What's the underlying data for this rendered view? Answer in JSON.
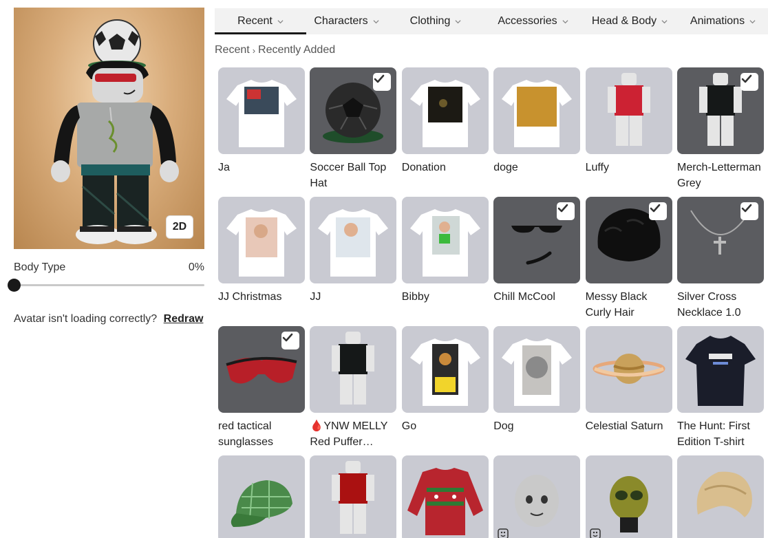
{
  "preview": {
    "toggle_label": "2D"
  },
  "body_type": {
    "label": "Body Type",
    "value": "0%",
    "fraction": 0
  },
  "redraw": {
    "text": "Avatar isn't loading correctly?",
    "link": "Redraw"
  },
  "tabs": [
    {
      "label": "Recent",
      "active": true
    },
    {
      "label": "Characters",
      "active": false
    },
    {
      "label": "Clothing",
      "active": false
    },
    {
      "label": "Accessories",
      "active": false
    },
    {
      "label": "Head & Body",
      "active": false
    },
    {
      "label": "Animations",
      "active": false
    }
  ],
  "breadcrumb": {
    "root": "Recent",
    "current": "Recently Added"
  },
  "items": [
    {
      "name": "Ja",
      "kind": "shirt",
      "worn": false,
      "dynamic": false
    },
    {
      "name": "Soccer Ball Top Hat",
      "kind": "soccer-hat",
      "worn": true,
      "dynamic": false
    },
    {
      "name": "Donation",
      "kind": "shirt",
      "worn": false,
      "dynamic": false
    },
    {
      "name": "doge",
      "kind": "shirt",
      "worn": false,
      "dynamic": false
    },
    {
      "name": "Luffy",
      "kind": "outfit",
      "worn": false,
      "dynamic": false
    },
    {
      "name": "Merch-Letterman Grey",
      "kind": "outfit",
      "worn": true,
      "dynamic": false
    },
    {
      "name": "JJ Christmas",
      "kind": "shirt",
      "worn": false,
      "dynamic": false
    },
    {
      "name": "JJ",
      "kind": "shirt",
      "worn": false,
      "dynamic": false
    },
    {
      "name": "Bibby",
      "kind": "shirt",
      "worn": false,
      "dynamic": false
    },
    {
      "name": "Chill McCool",
      "kind": "face",
      "worn": true,
      "dynamic": false
    },
    {
      "name": "Messy Black Curly Hair",
      "kind": "hair",
      "worn": true,
      "dynamic": false
    },
    {
      "name": "Silver Cross Necklace 1.0",
      "kind": "necklace",
      "worn": true,
      "dynamic": false
    },
    {
      "name": "red tactical sunglasses",
      "kind": "sunglasses",
      "worn": true,
      "dynamic": false
    },
    {
      "name": "🩸YNW MELLY Red Puffer…",
      "kind": "outfit",
      "worn": false,
      "dynamic": false
    },
    {
      "name": "Go",
      "kind": "shirt",
      "worn": false,
      "dynamic": false
    },
    {
      "name": "Dog",
      "kind": "shirt",
      "worn": false,
      "dynamic": false
    },
    {
      "name": "Celestial Saturn",
      "kind": "saturn",
      "worn": false,
      "dynamic": false
    },
    {
      "name": "The Hunt: First Edition T-shirt",
      "kind": "tshirt",
      "worn": false,
      "dynamic": false
    },
    {
      "name": "",
      "kind": "cap",
      "worn": false,
      "dynamic": false
    },
    {
      "name": "",
      "kind": "outfit",
      "worn": false,
      "dynamic": false
    },
    {
      "name": "",
      "kind": "sweater",
      "worn": false,
      "dynamic": false
    },
    {
      "name": "",
      "kind": "head",
      "worn": false,
      "dynamic": true
    },
    {
      "name": "",
      "kind": "alien-head",
      "worn": false,
      "dynamic": true
    },
    {
      "name": "",
      "kind": "blonde-hair",
      "worn": false,
      "dynamic": false
    }
  ]
}
